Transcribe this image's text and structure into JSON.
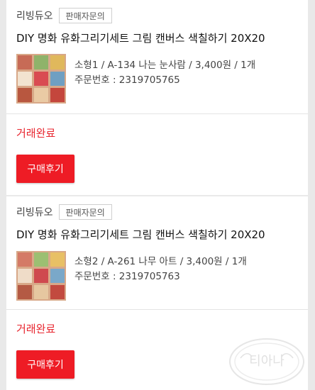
{
  "orders": [
    {
      "seller": "리빙듀오",
      "inquiry_label": "판매자문의",
      "product_title": "DIY 명화 유화그리기세트 그림 캔버스 색칠하기 20X20",
      "option": "소형1 / A-134 나는 눈사람 / 3,400원 / 1개",
      "order_number": "주문번호 : 2319705765",
      "status": "거래완료",
      "review_label": "구매후기"
    },
    {
      "seller": "리빙듀오",
      "inquiry_label": "판매자문의",
      "product_title": "DIY 명화 유화그리기세트 그림 캔버스 색칠하기 20X20",
      "option": "소형2 / A-261 나무 아트 / 3,400원 / 1개",
      "order_number": "주문번호 : 2319705763",
      "status": "거래완료",
      "review_label": "구매후기"
    }
  ],
  "watermark": {
    "text": "티아나"
  },
  "colors": {
    "accent": "#ee1c25",
    "status": "#e8262f"
  }
}
